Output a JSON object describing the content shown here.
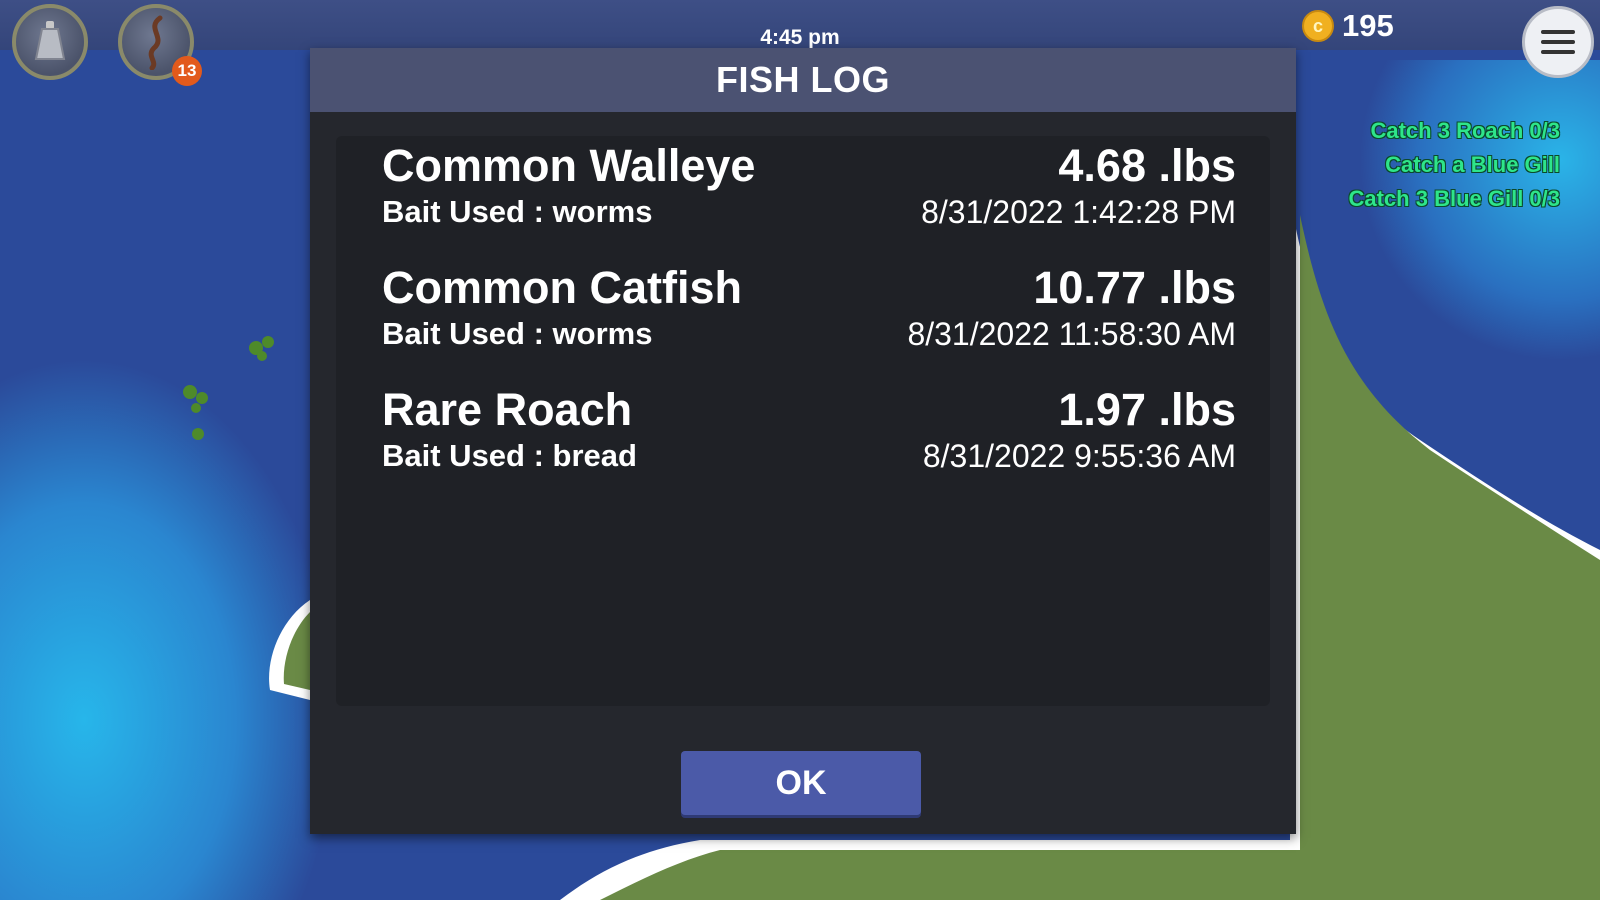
{
  "hud": {
    "time": "4:45 pm",
    "coins": "195",
    "bait_count": "13",
    "icons": {
      "weight": "sinker-icon",
      "bait": "worm-icon",
      "coin": "coin-icon",
      "menu": "hamburger-menu-icon"
    }
  },
  "quests": [
    "Catch 3 Roach 0/3",
    "Catch a Blue Gill",
    "Catch 3 Blue Gill 0/3"
  ],
  "dialog": {
    "title": "FISH LOG",
    "ok_label": "OK",
    "entries": [
      {
        "name": "Common Walleye",
        "bait": "Bait Used : worms",
        "weight": "4.68 .lbs",
        "timestamp": "8/31/2022 1:42:28 PM"
      },
      {
        "name": "Common Catfish",
        "bait": "Bait Used : worms",
        "weight": "10.77 .lbs",
        "timestamp": "8/31/2022 11:58:30 AM"
      },
      {
        "name": "Rare Roach",
        "bait": "Bait Used : bread",
        "weight": "1.97 .lbs",
        "timestamp": "8/31/2022 9:55:36 AM"
      }
    ]
  },
  "colors": {
    "water_deep": "#2b4a9a",
    "water_shallow": "#1fa2dc",
    "grass": "#6a8a46",
    "quest_text": "#2ee58a",
    "dialog_bg": "#25272d",
    "header_bg": "#4b5272",
    "ok_button": "#4b5aa8"
  }
}
